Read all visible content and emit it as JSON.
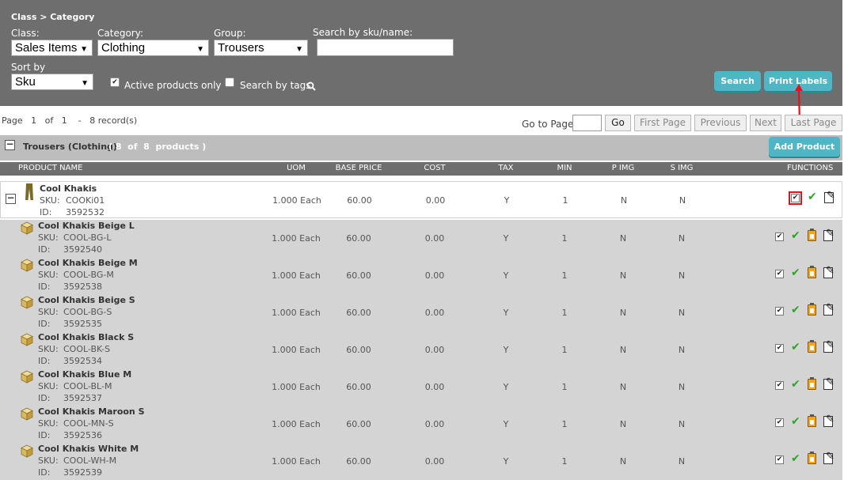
{
  "filters": {
    "breadcrumb": "Class > Category",
    "class": {
      "label": "Class:",
      "value": "Sales Items"
    },
    "category": {
      "label": "Category:",
      "value": "Clothing"
    },
    "group": {
      "label": "Group:",
      "value": "Trousers"
    },
    "search": {
      "label": "Search by sku/name:",
      "value": ""
    },
    "sort": {
      "label": "Sort by",
      "value": "Sku"
    },
    "active_only": {
      "label": "Active products only",
      "checked": true
    },
    "search_tags": {
      "label": "Search by tags",
      "checked": false
    },
    "search_button": "Search",
    "print_button": "Print Labels"
  },
  "pager": {
    "page_label": "Page",
    "current_page": "1",
    "of_label": "of",
    "total_pages": "1",
    "dash": "-",
    "records": "8 record(s)",
    "goto_label": "Go to Page",
    "go_button": "Go",
    "first": "First Page",
    "previous": "Previous",
    "next": "Next",
    "last": "Last Page"
  },
  "group": {
    "title": "Trousers (Clothing)",
    "count_text": "( 8  of  8  products )",
    "add_button": "Add Product"
  },
  "columns": {
    "name": "PRODUCT NAME",
    "uom": "UOM",
    "base_price": "BASE PRICE",
    "cost": "COST",
    "tax": "TAX",
    "min": "MIN",
    "p_img": "P IMG",
    "s_img": "S IMG",
    "functions": "FUNCTIONS"
  },
  "labels": {
    "sku": "SKU:",
    "id": "ID:"
  },
  "parent": {
    "name": "Cool Khakis",
    "sku": "COOKi01",
    "id": "3592532",
    "uom": "1.000 Each",
    "base_price": "60.00",
    "cost": "0.00",
    "tax": "Y",
    "min": "1",
    "p_img": "N",
    "s_img": "N"
  },
  "variants": [
    {
      "name": "Cool Khakis Beige L",
      "sku": "COOL-BG-L",
      "id": "3592540",
      "uom": "1.000 Each",
      "base_price": "60.00",
      "cost": "0.00",
      "tax": "Y",
      "min": "1",
      "p_img": "N",
      "s_img": "N"
    },
    {
      "name": "Cool Khakis Beige M",
      "sku": "COOL-BG-M",
      "id": "3592538",
      "uom": "1.000 Each",
      "base_price": "60.00",
      "cost": "0.00",
      "tax": "Y",
      "min": "1",
      "p_img": "N",
      "s_img": "N"
    },
    {
      "name": "Cool Khakis Beige S",
      "sku": "COOL-BG-S",
      "id": "3592535",
      "uom": "1.000 Each",
      "base_price": "60.00",
      "cost": "0.00",
      "tax": "Y",
      "min": "1",
      "p_img": "N",
      "s_img": "N"
    },
    {
      "name": "Cool Khakis Black S",
      "sku": "COOL-BK-S",
      "id": "3592534",
      "uom": "1.000 Each",
      "base_price": "60.00",
      "cost": "0.00",
      "tax": "Y",
      "min": "1",
      "p_img": "N",
      "s_img": "N"
    },
    {
      "name": "Cool Khakis Blue M",
      "sku": "COOL-BL-M",
      "id": "3592537",
      "uom": "1.000 Each",
      "base_price": "60.00",
      "cost": "0.00",
      "tax": "Y",
      "min": "1",
      "p_img": "N",
      "s_img": "N"
    },
    {
      "name": "Cool Khakis Maroon S",
      "sku": "COOL-MN-S",
      "id": "3592536",
      "uom": "1.000 Each",
      "base_price": "60.00",
      "cost": "0.00",
      "tax": "Y",
      "min": "1",
      "p_img": "N",
      "s_img": "N"
    },
    {
      "name": "Cool Khakis White M",
      "sku": "COOL-WH-M",
      "id": "3592539",
      "uom": "1.000 Each",
      "base_price": "60.00",
      "cost": "0.00",
      "tax": "Y",
      "min": "1",
      "p_img": "N",
      "s_img": "N"
    }
  ],
  "icons": {
    "product": "trousers-icon",
    "variant": "box-icon",
    "functions": [
      "checkbox",
      "check-icon",
      "clipboard-icon",
      "edit-icon"
    ]
  },
  "colors": {
    "panel": "#6e6e6e",
    "accent": "#4fb6c6",
    "highlight": "#e0141e",
    "approve": "#2aa52a"
  }
}
